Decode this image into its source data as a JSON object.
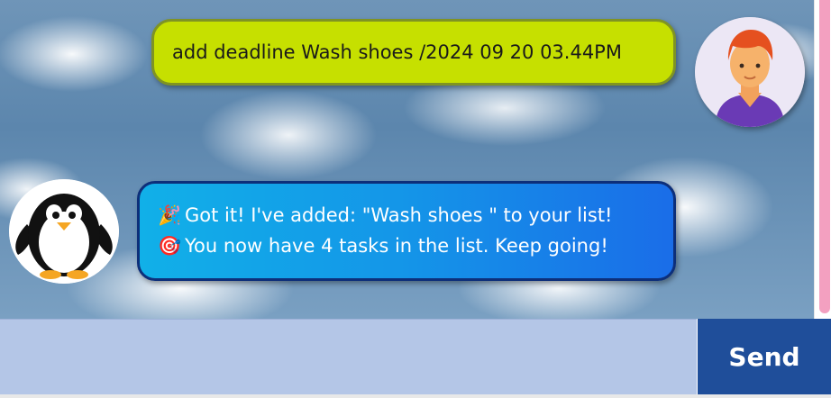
{
  "chat": {
    "messages": [
      {
        "sender": "user",
        "text": "add deadline Wash shoes /2024 09 20 03.44PM"
      },
      {
        "sender": "bot",
        "lines": [
          {
            "emoji": "🎉",
            "text": "Got it! I've added: \"Wash shoes \" to your list!"
          },
          {
            "emoji": "🎯",
            "text": "You now have 4 tasks in the list. Keep going!"
          }
        ]
      }
    ],
    "avatars": {
      "user": "person-avatar-icon",
      "bot": "penguin-avatar-icon"
    }
  },
  "input": {
    "value": "",
    "placeholder": ""
  },
  "send_button": {
    "label": "Send"
  },
  "colors": {
    "user_bubble": "#c6e000",
    "user_bubble_border": "#7f9324",
    "bot_bubble_start": "#11b0e8",
    "bot_bubble_end": "#1a6de8",
    "bot_bubble_border": "#0d2f7a",
    "input_bg": "#b4c6e7",
    "send_bg": "#1f4e9a",
    "scroll_thumb": "#f3a0c0"
  }
}
